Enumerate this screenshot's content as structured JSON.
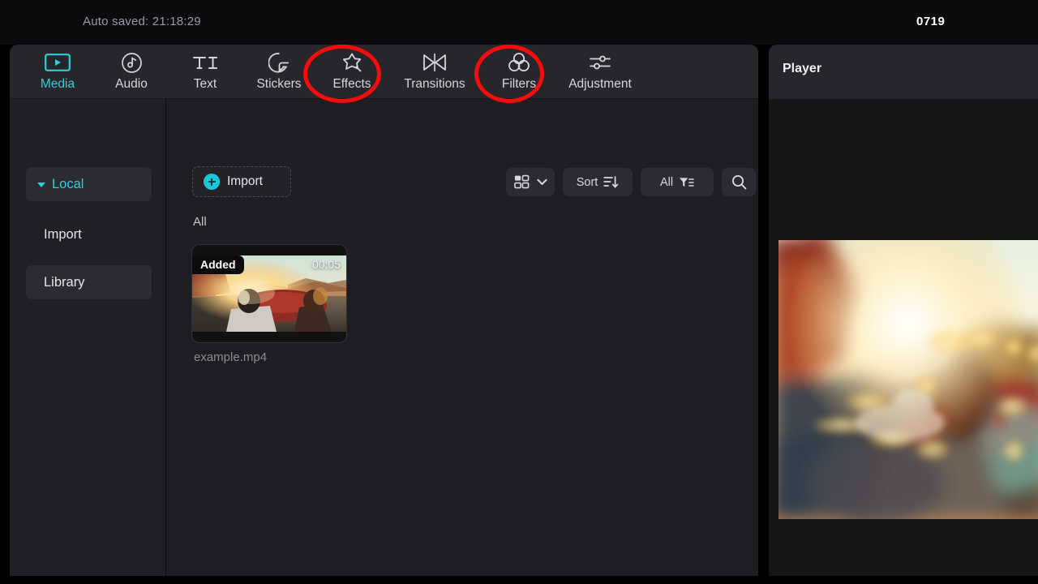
{
  "topbar": {
    "autosave_text": "Auto saved: 21:18:29",
    "project_code": "0719"
  },
  "nav": {
    "tabs": [
      {
        "label": "Media",
        "icon": "media-play-rect-icon",
        "active": true
      },
      {
        "label": "Audio",
        "icon": "audio-note-icon",
        "active": false
      },
      {
        "label": "Text",
        "icon": "text-ti-icon",
        "active": false
      },
      {
        "label": "Stickers",
        "icon": "sticker-icon",
        "active": false
      },
      {
        "label": "Effects",
        "icon": "effects-star-icon",
        "active": false
      },
      {
        "label": "Transitions",
        "icon": "transitions-icon",
        "active": false
      },
      {
        "label": "Filters",
        "icon": "filters-circles-icon",
        "active": false
      },
      {
        "label": "Adjustment",
        "icon": "adjustment-sliders-icon",
        "active": false
      }
    ]
  },
  "sidebar": {
    "items": [
      {
        "label": "Local",
        "type": "group",
        "expanded": true
      },
      {
        "label": "Import",
        "type": "plain",
        "expanded": false
      },
      {
        "label": "Library",
        "type": "selected",
        "expanded": false
      }
    ]
  },
  "toolbar": {
    "import_label": "Import",
    "view_icon": "grid-view-icon",
    "view_chevron_icon": "chevron-down-icon",
    "sort_label": "Sort",
    "sort_icon": "sort-descending-icon",
    "filter_label": "All",
    "filter_icon": "filter-funnel-icon",
    "search_icon": "search-icon"
  },
  "content": {
    "section_label": "All",
    "media_items": [
      {
        "filename": "example.mp4",
        "badge": "Added",
        "duration": "00:05"
      }
    ]
  },
  "player": {
    "title": "Player"
  },
  "annotations": [
    {
      "target": "Effects",
      "shape": "red-ellipse"
    },
    {
      "target": "Filters",
      "shape": "red-ellipse"
    }
  ],
  "colors": {
    "accent": "#2ecfd6",
    "annotation": "#f60c0c",
    "panel_bg": "#1e1e22",
    "navbar_bg": "#26262b",
    "sidebar_bg": "#202024"
  }
}
